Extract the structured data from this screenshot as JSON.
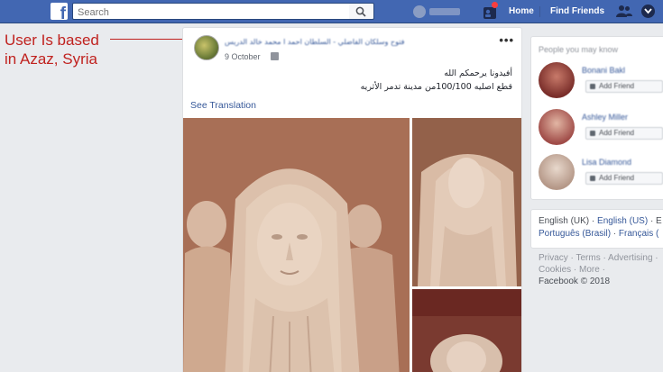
{
  "topbar": {
    "search_placeholder": "Search",
    "user_name": "",
    "nav": [
      "Home",
      "Find Friends"
    ]
  },
  "annotation": {
    "line1": "User Is based",
    "line2": "in Azaz, Syria",
    "color": "#c0221f"
  },
  "post": {
    "author": "ﻓﺘﻮﺡ ﻭﺳﻠﻜﺎﻥ ﺍﻟﻔﺎﺿﻠﻲ - ﺍﻟﺴﻠﻄﺎﻥ ﺍﺣﻤﺪ ﺍ ﻣﺤﻤﺪ ﺧﺎﻟﺪ ﺍﻟﺪﺭﻳﺲ",
    "date": "9 October",
    "more": "•••",
    "text_line1": "أفيدونا يرحمكم الله",
    "text_line2": "قطع اصليه 100/100من مدينة تدمر الأثريه",
    "see_translation": "See Translation"
  },
  "sidebar": {
    "title": "People you may know",
    "people": [
      {
        "name": "Bonani Bakl",
        "button": "Add Friend",
        "color": "#8a3e3a"
      },
      {
        "name": "Ashley Miller",
        "button": "Add Friend",
        "color": "#b0645e"
      },
      {
        "name": "Lisa Diamond",
        "button": "Add Friend",
        "color": "#c9b6a8"
      }
    ]
  },
  "languages": {
    "line1_current": "English (UK)",
    "line1_sep": " · ",
    "line1_link": "English (US)",
    "line1_tail": " · E",
    "line2_link1": "Português (Brasil)",
    "line2_sep": " · ",
    "line2_link2": "Français ("
  },
  "footer": {
    "line1": "Privacy · Terms · Advertising ·",
    "line2": "Cookies · More ·",
    "line3": "Facebook © 2018"
  },
  "colors": {
    "brand": "#4267b2",
    "link": "#365899",
    "annotation": "#c0221f"
  },
  "icons": [
    "facebook-logo-icon",
    "search-icon",
    "friend-requests-icon",
    "friends-icon",
    "help-icon",
    "globe-icon",
    "more-icon"
  ]
}
